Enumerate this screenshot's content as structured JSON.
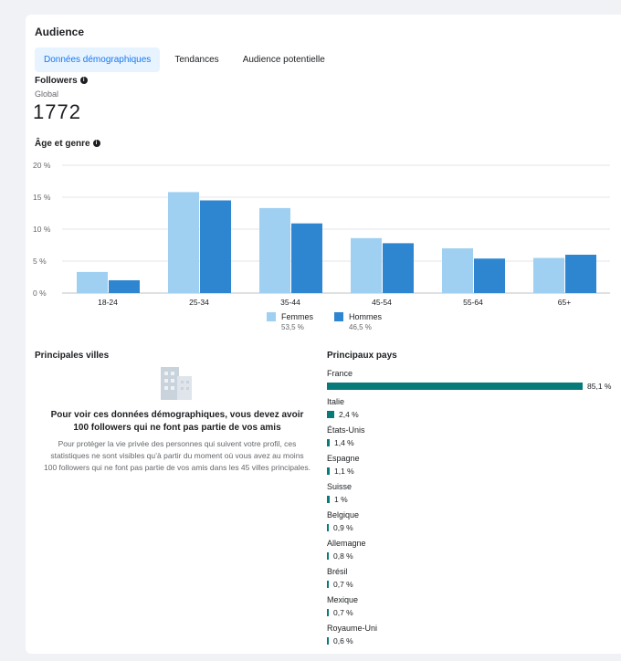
{
  "audience": {
    "title": "Audience",
    "tabs": [
      {
        "label": "Données démographiques",
        "active": true
      },
      {
        "label": "Tendances",
        "active": false
      },
      {
        "label": "Audience potentielle",
        "active": false
      }
    ],
    "followers_label": "Followers",
    "scope": "Global",
    "followers_count": "1772",
    "age_gender_title": "Âge et genre"
  },
  "chart_data": {
    "type": "bar",
    "categories": [
      "18-24",
      "25-34",
      "35-44",
      "45-54",
      "55-64",
      "65+"
    ],
    "series": [
      {
        "name": "Femmes",
        "values": [
          3.3,
          15.8,
          13.3,
          8.6,
          7.0,
          5.5
        ],
        "color": "#9fd0f2"
      },
      {
        "name": "Hommes",
        "values": [
          2.0,
          14.5,
          10.9,
          7.8,
          5.4,
          6.0
        ],
        "color": "#2e86d1"
      }
    ],
    "ytick_labels": [
      "0 %",
      "5 %",
      "10 %",
      "15 %",
      "20 %"
    ],
    "ylim": [
      0,
      20
    ],
    "grid": true,
    "legend_placement": "bottom-center"
  },
  "legend": [
    {
      "label": "Femmes",
      "pct": "53,5 %",
      "color": "#9fd0f2"
    },
    {
      "label": "Hommes",
      "pct": "46,5 %",
      "color": "#2e86d1"
    }
  ],
  "cities": {
    "title": "Principales villes",
    "headline": "Pour voir ces données démographiques, vous devez avoir 100 followers qui ne font pas partie de vos amis",
    "body": "Pour protéger la vie privée des personnes qui suivent votre profil, ces statistiques ne sont visibles qu’à partir du moment où vous avez au moins 100 followers qui ne font pas partie de vos amis dans les 45 villes principales."
  },
  "countries": {
    "title": "Principaux pays",
    "bar_color": "#087a7a",
    "items": [
      {
        "name": "France",
        "value": 85.1,
        "label": "85,1 %"
      },
      {
        "name": "Italie",
        "value": 2.4,
        "label": "2,4 %"
      },
      {
        "name": "États-Unis",
        "value": 1.4,
        "label": "1,4 %"
      },
      {
        "name": "Espagne",
        "value": 1.1,
        "label": "1,1 %"
      },
      {
        "name": "Suisse",
        "value": 1.0,
        "label": "1 %"
      },
      {
        "name": "Belgique",
        "value": 0.9,
        "label": "0,9 %"
      },
      {
        "name": "Allemagne",
        "value": 0.8,
        "label": "0,8 %"
      },
      {
        "name": "Brésil",
        "value": 0.7,
        "label": "0,7 %"
      },
      {
        "name": "Mexique",
        "value": 0.7,
        "label": "0,7 %"
      },
      {
        "name": "Royaume-Uni",
        "value": 0.6,
        "label": "0,6 %"
      }
    ]
  }
}
